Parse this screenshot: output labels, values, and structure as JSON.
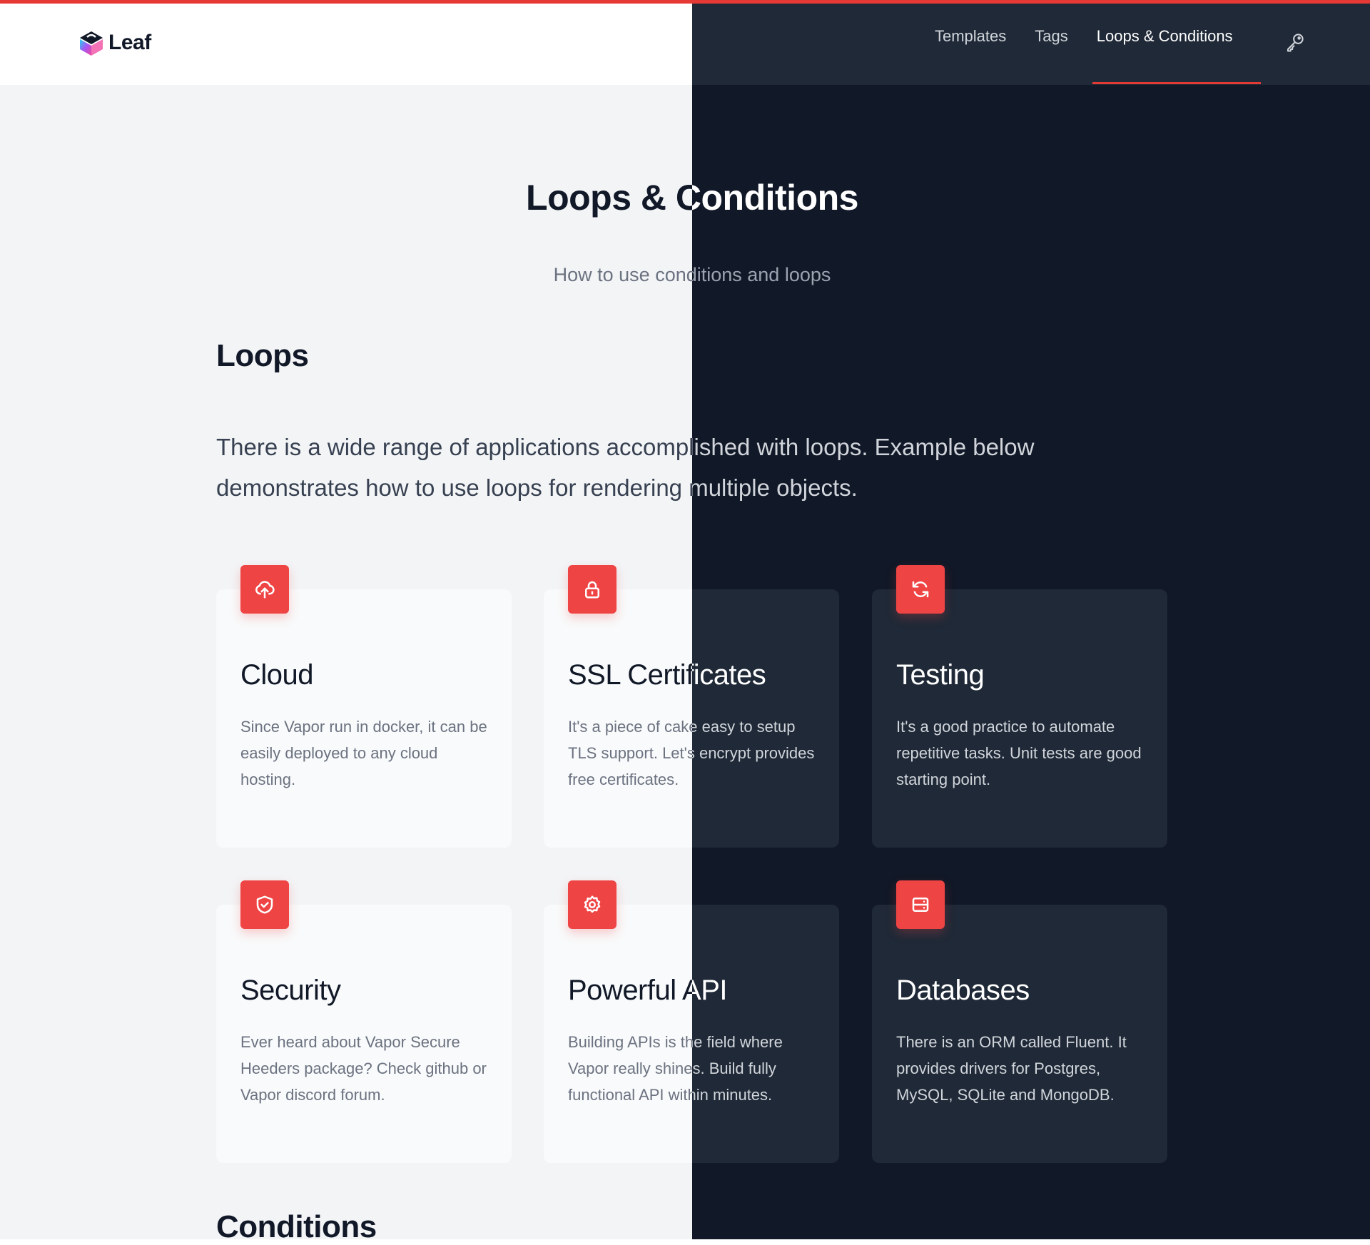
{
  "brand": {
    "name": "Leaf"
  },
  "nav": {
    "links": [
      {
        "label": "Templates"
      },
      {
        "label": "Tags"
      },
      {
        "label": "Loops & Conditions",
        "active": true
      }
    ],
    "icon": "key-icon"
  },
  "page": {
    "title": "Loops & Conditions",
    "subtitle": "How to use conditions and loops"
  },
  "loops": {
    "title": "Loops",
    "intro": "There is a wide range of applications accomplished with loops. Example below demonstrates how to use loops for rendering multiple objects.",
    "cards": [
      {
        "icon": "cloud-upload-icon",
        "title": "Cloud",
        "desc": "Since Vapor run in docker, it can be easily deployed to any cloud hosting."
      },
      {
        "icon": "lock-icon",
        "title": "SSL Certificates",
        "desc": "It's a piece of cake easy to setup TLS support. Let's encrypt provides free certificates."
      },
      {
        "icon": "refresh-icon",
        "title": "Testing",
        "desc": "It's a good practice to automate repetitive tasks. Unit tests are good starting point."
      },
      {
        "icon": "shield-check-icon",
        "title": "Security",
        "desc": "Ever heard about Vapor Secure Heeders package? Check github or Vapor discord forum."
      },
      {
        "icon": "cog-icon",
        "title": "Powerful API",
        "desc": "Building APIs is the field where Vapor really shines. Build fully functional API within minutes."
      },
      {
        "icon": "server-icon",
        "title": "Databases",
        "desc": "There is an ORM called Fluent. It provides drivers for Postgres, MySQL, SQLite and MongoDB."
      }
    ]
  },
  "conditions": {
    "title": "Conditions"
  },
  "colors": {
    "accent": "#ef4444",
    "top_bar": "#e53935",
    "light_bg": "#f3f4f6",
    "dark_bg": "#111827",
    "dark_card": "#1f2937"
  }
}
